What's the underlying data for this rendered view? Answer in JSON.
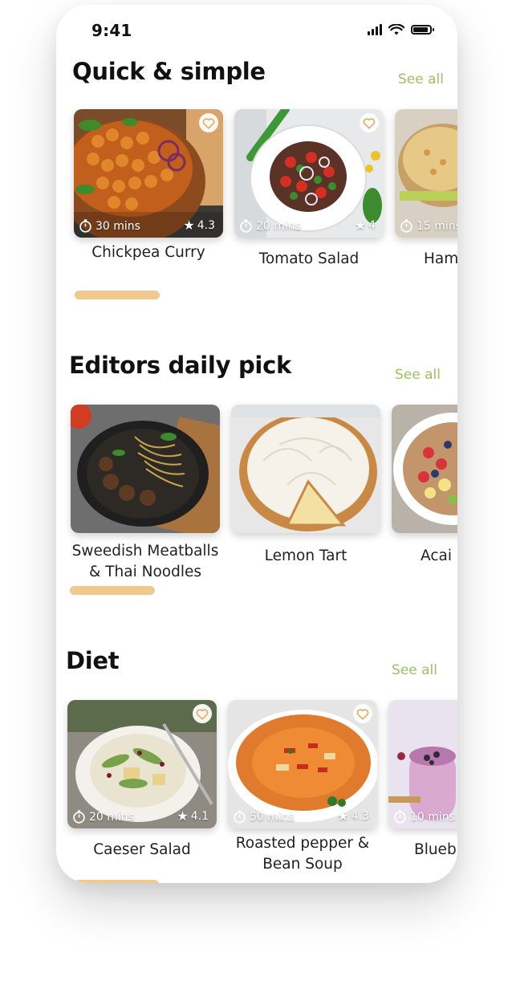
{
  "status_bar": {
    "time": "9:41"
  },
  "sections": [
    {
      "title": "Quick & simple",
      "see_all": "See all",
      "cards": [
        {
          "name": "Chickpea Curry",
          "time": "30 mins",
          "rating": "4.3",
          "image": "chickpea-curry-photo"
        },
        {
          "name": "Tomato Salad",
          "time": "20 mins",
          "rating": "4",
          "image": "tomato-salad-photo"
        },
        {
          "name": "Ham",
          "time": "15 mins",
          "rating": "",
          "image": "ham-sandwich-photo"
        }
      ]
    },
    {
      "title": "Editors daily pick",
      "see_all": "See all",
      "cards": [
        {
          "name_line1": "Sweedish Meatballs",
          "name_line2": "& Thai Noodles",
          "image": "meatballs-noodles-photo"
        },
        {
          "name_line1": "Lemon Tart",
          "name_line2": "",
          "image": "lemon-tart-photo"
        },
        {
          "name_line1": "Acai",
          "name_line2": "",
          "image": "acai-bowl-photo"
        }
      ]
    },
    {
      "title": "Diet",
      "see_all": "See all",
      "cards": [
        {
          "name_line1": "Caeser Salad",
          "name_line2": "",
          "time": "20 mins",
          "rating": "4.1",
          "image": "caeser-salad-photo"
        },
        {
          "name_line1": "Roasted pepper &",
          "name_line2": "Bean Soup",
          "time": "50 mins",
          "rating": "4.3",
          "image": "pepper-soup-photo"
        },
        {
          "name_line1": "Blueb",
          "name_line2": "",
          "time": "10 mins",
          "rating": "",
          "image": "blueberry-smoothie-photo"
        }
      ]
    }
  ],
  "colors": {
    "accent_green": "#9dc164",
    "scroll_indicator": "#f1c88d",
    "heart": "#e8a85a"
  }
}
